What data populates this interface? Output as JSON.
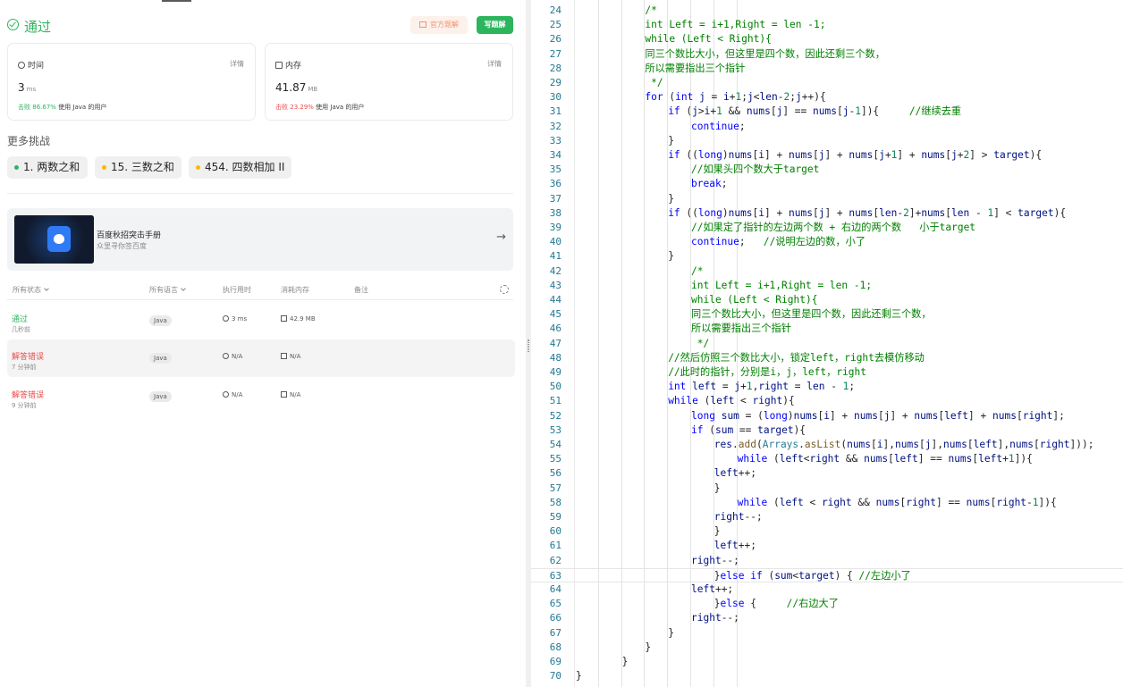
{
  "result": {
    "status": "通过",
    "official_solution_label": "官方题解",
    "write_solution_label": "写题解"
  },
  "runtime_card": {
    "title": "时间",
    "detail": "详情",
    "value": "3",
    "unit": "ms",
    "beats_prefix": "击败 ",
    "beats_pct": "86.67%",
    "beats_suffix": " 使用 Java 的用户"
  },
  "memory_card": {
    "title": "内存",
    "detail": "详情",
    "value": "41.87",
    "unit": "MB",
    "beats_prefix": "击败 ",
    "beats_pct": "23.29%",
    "beats_suffix": " 使用 Java 的用户"
  },
  "more_challenges": {
    "title": "更多挑战",
    "items": [
      {
        "label": "1. 两数之和",
        "dot_color": "#2db55d"
      },
      {
        "label": "15. 三数之和",
        "dot_color": "#ffb800"
      },
      {
        "label": "454. 四数相加 II",
        "dot_color": "#ffb800"
      }
    ]
  },
  "banner": {
    "title": "百度秋招突击手册",
    "subtitle": "众里寻你签百度"
  },
  "submissions": {
    "headers": {
      "status": "所有状态",
      "language": "所有语言",
      "runtime": "执行用时",
      "memory": "消耗内存",
      "notes": "备注"
    },
    "rows": [
      {
        "status": "通过",
        "ago": "几秒前",
        "language": "Java",
        "runtime": "3 ms",
        "memory": "42.9 MB"
      },
      {
        "status": "解答错误",
        "ago": "7 分钟前",
        "language": "Java",
        "runtime": "N/A",
        "memory": "N/A"
      },
      {
        "status": "解答错误",
        "ago": "9 分钟前",
        "language": "Java",
        "runtime": "N/A",
        "memory": "N/A"
      }
    ]
  },
  "editor": {
    "lines": [
      {
        "n": "24",
        "html": "<span class=\"c\">/*</span>"
      },
      {
        "n": "25",
        "html": "<span class=\"c\">int Left = i+1,Right = len -1;</span>"
      },
      {
        "n": "26",
        "html": "<span class=\"c\">while (Left &lt; Right){</span>"
      },
      {
        "n": "27",
        "html": "<span class=\"c\">同三个数比大小，但这里是四个数，因此还剩三个数，</span>"
      },
      {
        "n": "28",
        "html": "<span class=\"c\">所以需要指出三个指针</span>"
      },
      {
        "n": "29",
        "html": "<span class=\"c\"> */</span>"
      },
      {
        "n": "30",
        "html": "<span class=\"k\">for</span> (<span class=\"k\">int</span> <span class=\"v\">j</span> = <span class=\"v\">i</span>+<span class=\"n\">1</span>;<span class=\"v\">j</span>&lt;<span class=\"v\">len</span>-<span class=\"n\">2</span>;<span class=\"v\">j</span>++){"
      },
      {
        "n": "31",
        "html": "<span class=\"k\">if</span> (<span class=\"v\">j</span>&gt;<span class=\"v\">i</span>+<span class=\"n\">1</span> &amp;&amp; <span class=\"v\">nums</span>[<span class=\"v\">j</span>] == <span class=\"v\">nums</span>[<span class=\"v\">j</span>-<span class=\"n\">1</span>]){     <span class=\"c\">//继续去重</span>"
      },
      {
        "n": "32",
        "html": "<span class=\"k\">continue</span>;"
      },
      {
        "n": "33",
        "html": "}"
      },
      {
        "n": "34",
        "html": "<span class=\"k\">if</span> ((<span class=\"k\">long</span>)<span class=\"v\">nums</span>[<span class=\"v\">i</span>] + <span class=\"v\">nums</span>[<span class=\"v\">j</span>] + <span class=\"v\">nums</span>[<span class=\"v\">j</span>+<span class=\"n\">1</span>] + <span class=\"v\">nums</span>[<span class=\"v\">j</span>+<span class=\"n\">2</span>] &gt; <span class=\"v\">target</span>){"
      },
      {
        "n": "35",
        "html": "<span class=\"c\">//如果头四个数大于target</span>"
      },
      {
        "n": "36",
        "html": "<span class=\"k\">break</span>;"
      },
      {
        "n": "37",
        "html": "}"
      },
      {
        "n": "38",
        "html": "<span class=\"k\">if</span> ((<span class=\"k\">long</span>)<span class=\"v\">nums</span>[<span class=\"v\">i</span>] + <span class=\"v\">nums</span>[<span class=\"v\">j</span>] + <span class=\"v\">nums</span>[<span class=\"v\">len</span>-<span class=\"n\">2</span>]+<span class=\"v\">nums</span>[<span class=\"v\">len</span> - <span class=\"n\">1</span>] &lt; <span class=\"v\">target</span>){"
      },
      {
        "n": "39",
        "html": "<span class=\"c\">//如果定了指针的左边两个数 + 右边的两个数   小于target</span>"
      },
      {
        "n": "40",
        "html": "<span class=\"k\">continue</span>;   <span class=\"c\">//说明左边的数，小了</span>"
      },
      {
        "n": "41",
        "html": "}"
      },
      {
        "n": "42",
        "html": "<span class=\"c\">/*</span>"
      },
      {
        "n": "43",
        "html": "<span class=\"c\">int Left = i+1,Right = len -1;</span>"
      },
      {
        "n": "44",
        "html": "<span class=\"c\">while (Left &lt; Right){</span>"
      },
      {
        "n": "45",
        "html": "<span class=\"c\">同三个数比大小，但这里是四个数，因此还剩三个数，</span>"
      },
      {
        "n": "46",
        "html": "<span class=\"c\">所以需要指出三个指针</span>"
      },
      {
        "n": "47",
        "html": "<span class=\"c\"> */</span>"
      },
      {
        "n": "48",
        "html": "<span class=\"c\">//然后仿照三个数比大小，锁定left，right去模仿移动</span>"
      },
      {
        "n": "49",
        "html": "<span class=\"c\">//此时的指针，分别是i，j，left，right</span>"
      },
      {
        "n": "50",
        "html": "<span class=\"k\">int</span> <span class=\"v\">left</span> = <span class=\"v\">j</span>+<span class=\"n\">1</span>,<span class=\"v\">right</span> = <span class=\"v\">len</span> - <span class=\"n\">1</span>;"
      },
      {
        "n": "51",
        "html": "<span class=\"k\">while</span> (<span class=\"v\">left</span> &lt; <span class=\"v\">right</span>){"
      },
      {
        "n": "52",
        "html": "<span class=\"k\">long</span> <span class=\"v\">sum</span> = (<span class=\"k\">long</span>)<span class=\"v\">nums</span>[<span class=\"v\">i</span>] + <span class=\"v\">nums</span>[<span class=\"v\">j</span>] + <span class=\"v\">nums</span>[<span class=\"v\">left</span>] + <span class=\"v\">nums</span>[<span class=\"v\">right</span>];"
      },
      {
        "n": "53",
        "html": "<span class=\"k\">if</span> (<span class=\"v\">sum</span> == <span class=\"v\">target</span>){"
      },
      {
        "n": "54",
        "html": "<span class=\"v\">res</span>.<span class=\"f\">add</span>(<span class=\"t\">Arrays</span>.<span class=\"f\">asList</span>(<span class=\"v\">nums</span>[<span class=\"v\">i</span>],<span class=\"v\">nums</span>[<span class=\"v\">j</span>],<span class=\"v\">nums</span>[<span class=\"v\">left</span>],<span class=\"v\">nums</span>[<span class=\"v\">right</span>]));"
      },
      {
        "n": "55",
        "html": "<span class=\"k\">while</span> (<span class=\"v\">left</span>&lt;<span class=\"v\">right</span> &amp;&amp; <span class=\"v\">nums</span>[<span class=\"v\">left</span>] == <span class=\"v\">nums</span>[<span class=\"v\">left</span>+<span class=\"n\">1</span>]){"
      },
      {
        "n": "56",
        "html": "<span class=\"v\">left</span>++;"
      },
      {
        "n": "57",
        "html": "}"
      },
      {
        "n": "58",
        "html": "<span class=\"k\">while</span> (<span class=\"v\">left</span> &lt; <span class=\"v\">right</span> &amp;&amp; <span class=\"v\">nums</span>[<span class=\"v\">right</span>] == <span class=\"v\">nums</span>[<span class=\"v\">right</span>-<span class=\"n\">1</span>]){"
      },
      {
        "n": "59",
        "html": "<span class=\"v\">right</span>--;"
      },
      {
        "n": "60",
        "html": "}"
      },
      {
        "n": "61",
        "html": "<span class=\"v\">left</span>++;"
      },
      {
        "n": "62",
        "html": "<span class=\"v\">right</span>--;"
      },
      {
        "n": "63",
        "html": "}<span class=\"k\">else if</span> (<span class=\"v\">sum</span>&lt;<span class=\"v\">target</span>) { <span class=\"c\">//左边小了</span>"
      },
      {
        "n": "64",
        "html": "<span class=\"v\">left</span>++;"
      },
      {
        "n": "65",
        "html": "}<span class=\"k\">else</span> {     <span class=\"c\">//右边大了</span>"
      },
      {
        "n": "66",
        "html": "<span class=\"v\">right</span>--;"
      },
      {
        "n": "67",
        "html": "}"
      },
      {
        "n": "68",
        "html": "}"
      },
      {
        "n": "69",
        "html": "}"
      },
      {
        "n": "70",
        "html": "}"
      }
    ]
  }
}
